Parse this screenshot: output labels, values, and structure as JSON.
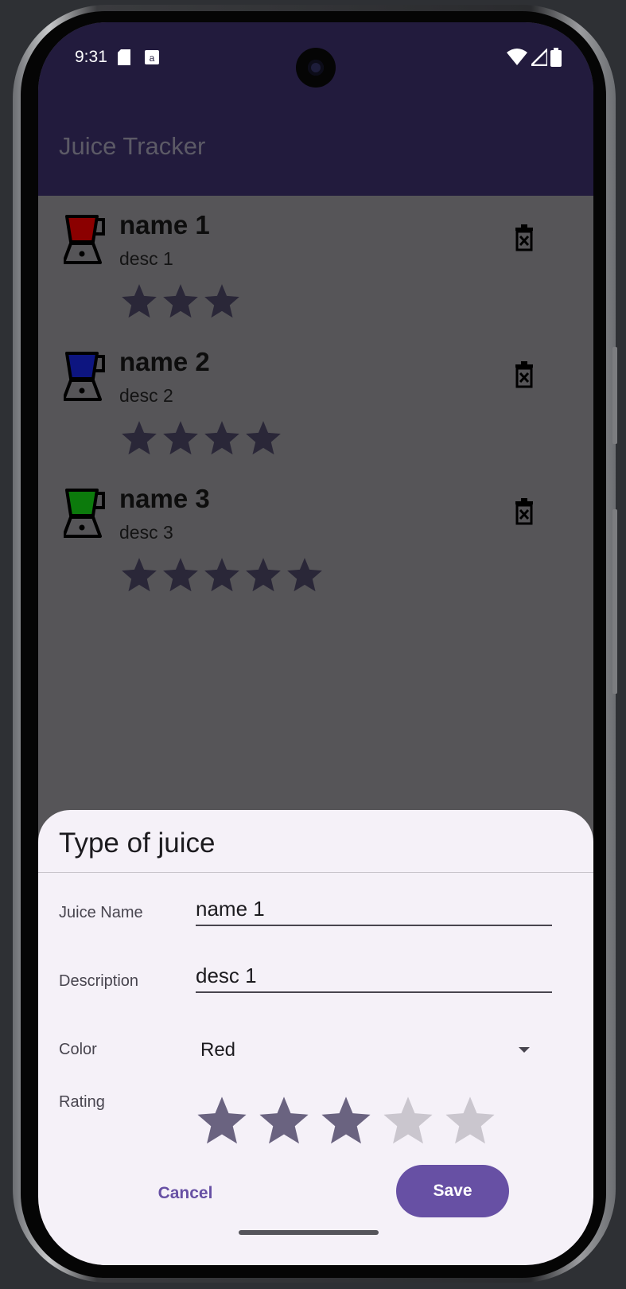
{
  "status_bar": {
    "time": "9:31",
    "left_icons": [
      "sd-card-icon",
      "notification-app-icon"
    ],
    "right_icons": [
      "wifi-icon",
      "cell-signal-icon",
      "battery-icon"
    ]
  },
  "app_bar": {
    "title": "Juice Tracker"
  },
  "juices": [
    {
      "name": "name 1",
      "description": "desc 1",
      "rating": 3,
      "color": "#8b0000"
    },
    {
      "name": "name 2",
      "description": "desc 2",
      "rating": 4,
      "color": "#0d1580"
    },
    {
      "name": "name 3",
      "description": "desc 3",
      "rating": 5,
      "color": "#0c7a0c"
    }
  ],
  "sheet": {
    "title": "Type of juice",
    "name_label": "Juice Name",
    "name_value": "name 1",
    "description_label": "Description",
    "description_value": "desc 1",
    "color_label": "Color",
    "color_value": "Red",
    "rating_label": "Rating",
    "rating_value": 3,
    "rating_max": 5,
    "cancel_label": "Cancel",
    "save_label": "Save"
  },
  "colors": {
    "accent": "#6750a4",
    "app_bar": "#221b3d",
    "scrim_bg": "#565558",
    "sheet_bg": "#f5f1f8",
    "star_filled": "#6a6380",
    "star_empty": "#cac6ce",
    "list_star": "#2a2738"
  }
}
